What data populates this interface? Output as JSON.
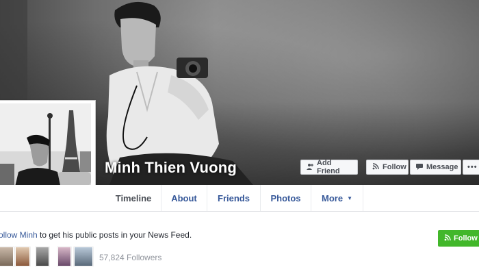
{
  "profile": {
    "name": "Minh Thien Vuong"
  },
  "cover_actions": {
    "add_friend": "Add Friend",
    "follow": "Follow",
    "message": "Message",
    "more": "•••"
  },
  "tabs": [
    {
      "label": "Timeline"
    },
    {
      "label": "About"
    },
    {
      "label": "Friends"
    },
    {
      "label": "Photos"
    },
    {
      "label": "More"
    }
  ],
  "follow_prompt": {
    "link": "ollow Minh",
    "rest": " to get his public posts in your News Feed.",
    "button": "Follow"
  },
  "followers": {
    "count_text": "57,824 Followers"
  },
  "colors": {
    "link": "#365899",
    "green": "#42b72a"
  },
  "icons": {
    "add_friend": "person-plus-icon",
    "follow": "rss-icon",
    "message": "message-icon",
    "more": "ellipsis-icon",
    "caret": "caret-down-icon"
  }
}
